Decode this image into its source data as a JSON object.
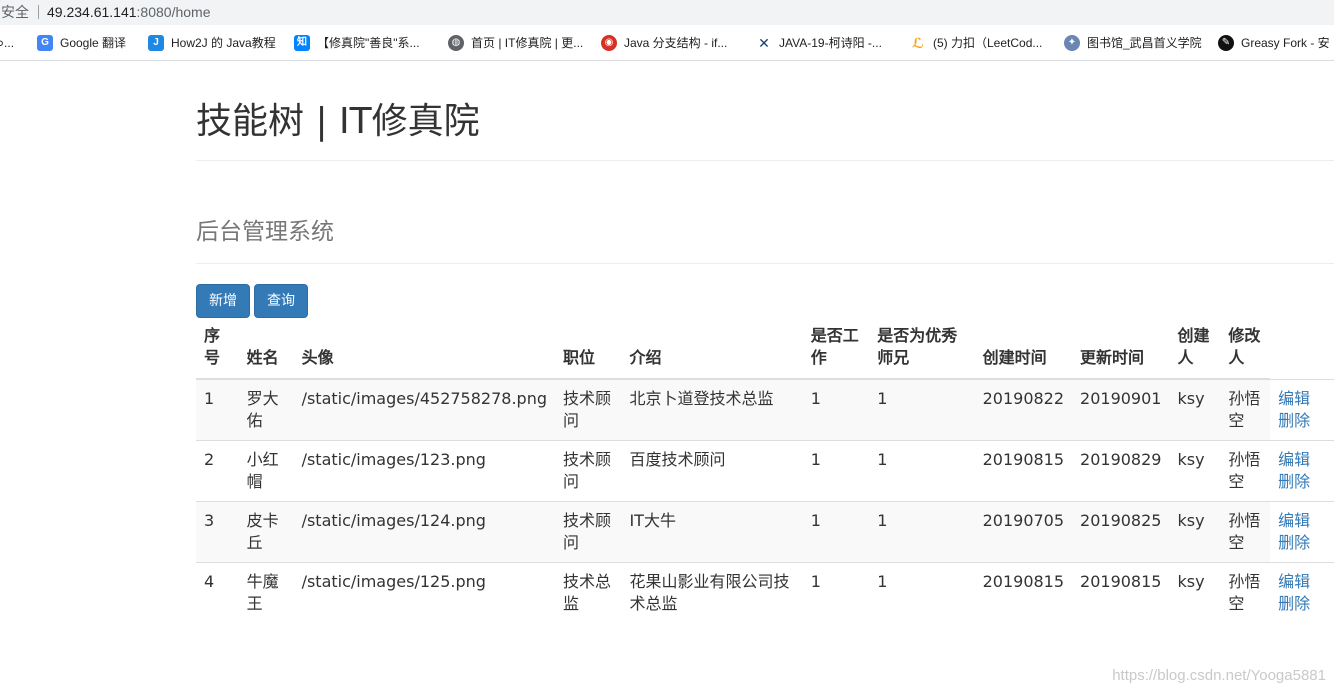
{
  "browser": {
    "security": "安全",
    "url_host": "49.234.61.141",
    "url_path": ":8080/home",
    "bookmarks": [
      {
        "label": "⊃...",
        "icon": "blank-icon"
      },
      {
        "label": "Google 翻译",
        "icon": "google-translate-icon"
      },
      {
        "label": "How2J 的 Java教程",
        "icon": "how2j-icon"
      },
      {
        "label": "【修真院\"善良\"系...",
        "icon": "zhihu-icon"
      },
      {
        "label": "首页 | IT修真院 | 更...",
        "icon": "globe-icon"
      },
      {
        "label": "Java 分支结构 - if...",
        "icon": "runoob-icon"
      },
      {
        "label": "JAVA-19-柯诗阳 -...",
        "icon": "tools-icon"
      },
      {
        "label": "(5) 力扣（LeetCod...",
        "icon": "leetcode-icon"
      },
      {
        "label": "图书馆_武昌首义学院",
        "icon": "library-icon"
      },
      {
        "label": "Greasy Fork - 安",
        "icon": "greasyfork-icon"
      }
    ]
  },
  "page": {
    "title": "技能树 | IT修真院",
    "subtitle": "后台管理系统",
    "add_label": "新增",
    "query_label": "查询"
  },
  "table": {
    "headers": [
      "序号",
      "姓名",
      "头像",
      "职位",
      "介绍",
      "是否工作",
      "是否为优秀师兄",
      "创建时间",
      "更新时间",
      "创建人",
      "修改人"
    ],
    "rows": [
      {
        "id": "1",
        "name": "罗大佑",
        "avatar": "/static/images/452758278.png",
        "position": "技术顾问",
        "intro": "北京卜道登技术总监",
        "working": "1",
        "excellent": "1",
        "created": "20190822",
        "updated": "20190901",
        "creator": "ksy",
        "modifier": "孙悟空",
        "edit": "编辑",
        "delete": "删除"
      },
      {
        "id": "2",
        "name": "小红帽",
        "avatar": "/static/images/123.png",
        "position": "技术顾问",
        "intro": "百度技术顾问",
        "working": "1",
        "excellent": "1",
        "created": "20190815",
        "updated": "20190829",
        "creator": "ksy",
        "modifier": "孙悟空",
        "edit": "编辑",
        "delete": "删除"
      },
      {
        "id": "3",
        "name": "皮卡丘",
        "avatar": "/static/images/124.png",
        "position": "技术顾问",
        "intro": "IT大牛",
        "working": "1",
        "excellent": "1",
        "created": "20190705",
        "updated": "20190825",
        "creator": "ksy",
        "modifier": "孙悟空",
        "edit": "编辑",
        "delete": "删除"
      },
      {
        "id": "4",
        "name": "牛魔王",
        "avatar": "/static/images/125.png",
        "position": "技术总监",
        "intro": "花果山影业有限公司技术总监",
        "working": "1",
        "excellent": "1",
        "created": "20190815",
        "updated": "20190815",
        "creator": "ksy",
        "modifier": "孙悟空",
        "edit": "编辑",
        "delete": "删除"
      }
    ]
  },
  "watermark": "https://blog.csdn.net/Yooga5881",
  "colors": {
    "primary": "#337ab7",
    "stripe": "#f9f9f9",
    "border": "#dddddd"
  }
}
